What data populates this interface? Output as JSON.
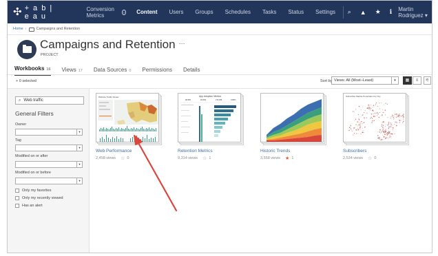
{
  "topnav": {
    "logo_text": "+ a b | e a u",
    "site_name": "Conversion Metrics",
    "links": [
      "Content",
      "Users",
      "Groups",
      "Schedules",
      "Tasks",
      "Status",
      "Settings"
    ],
    "user": "Martin Rodriguez ▾"
  },
  "breadcrumb": {
    "home": "Home",
    "separator": "›",
    "current": "Campaigns and Retention"
  },
  "project": {
    "title": "Campaigns and Retention",
    "more": "···",
    "type_label": "PROJECT"
  },
  "tabs": [
    {
      "label": "Workbooks",
      "count": "16"
    },
    {
      "label": "Views",
      "count": "17"
    },
    {
      "label": "Data Sources",
      "count": "0"
    },
    {
      "label": "Permissions",
      "count": ""
    },
    {
      "label": "Details",
      "count": ""
    }
  ],
  "toolbar": {
    "selected": "+ 0 selected",
    "sort_label": "Sort by",
    "sort_value": "Views: All (Most–Least)"
  },
  "filters": {
    "search_value": "Web traffic",
    "heading": "General Filters",
    "owner": "Owner",
    "tag": "Tag",
    "modified_after": "Modified on or after",
    "modified_before": "Modified on or before",
    "checks": [
      "Only my favorites",
      "Only my recently viewed",
      "Has an alert"
    ]
  },
  "workbooks": [
    {
      "name": "Web Performance",
      "views": "2,498 views",
      "favorites": "0",
      "favorited": false
    },
    {
      "name": "Retention Metrics",
      "views": "9,314 views",
      "favorites": "1",
      "favorited": false
    },
    {
      "name": "Historic Trends",
      "views": "3,558 views",
      "favorites": "1",
      "favorited": true
    },
    {
      "name": "Subscribers",
      "views": "2,534 views",
      "favorites": "0",
      "favorited": false
    }
  ],
  "thumb_titles": {
    "web_performance": "Website Traffic Viewer",
    "retention": "App Adoption Metrics",
    "subscribers": "Subscriber Market Penetration by City"
  },
  "retention_kpis": [
    "96,565",
    "20,609",
    "273,395",
    "0.86%"
  ],
  "colors": {
    "nav_bg": "#22355b",
    "link": "#3b6ea5",
    "arrow": "#d9473f",
    "fav_star": "#e0592a"
  }
}
